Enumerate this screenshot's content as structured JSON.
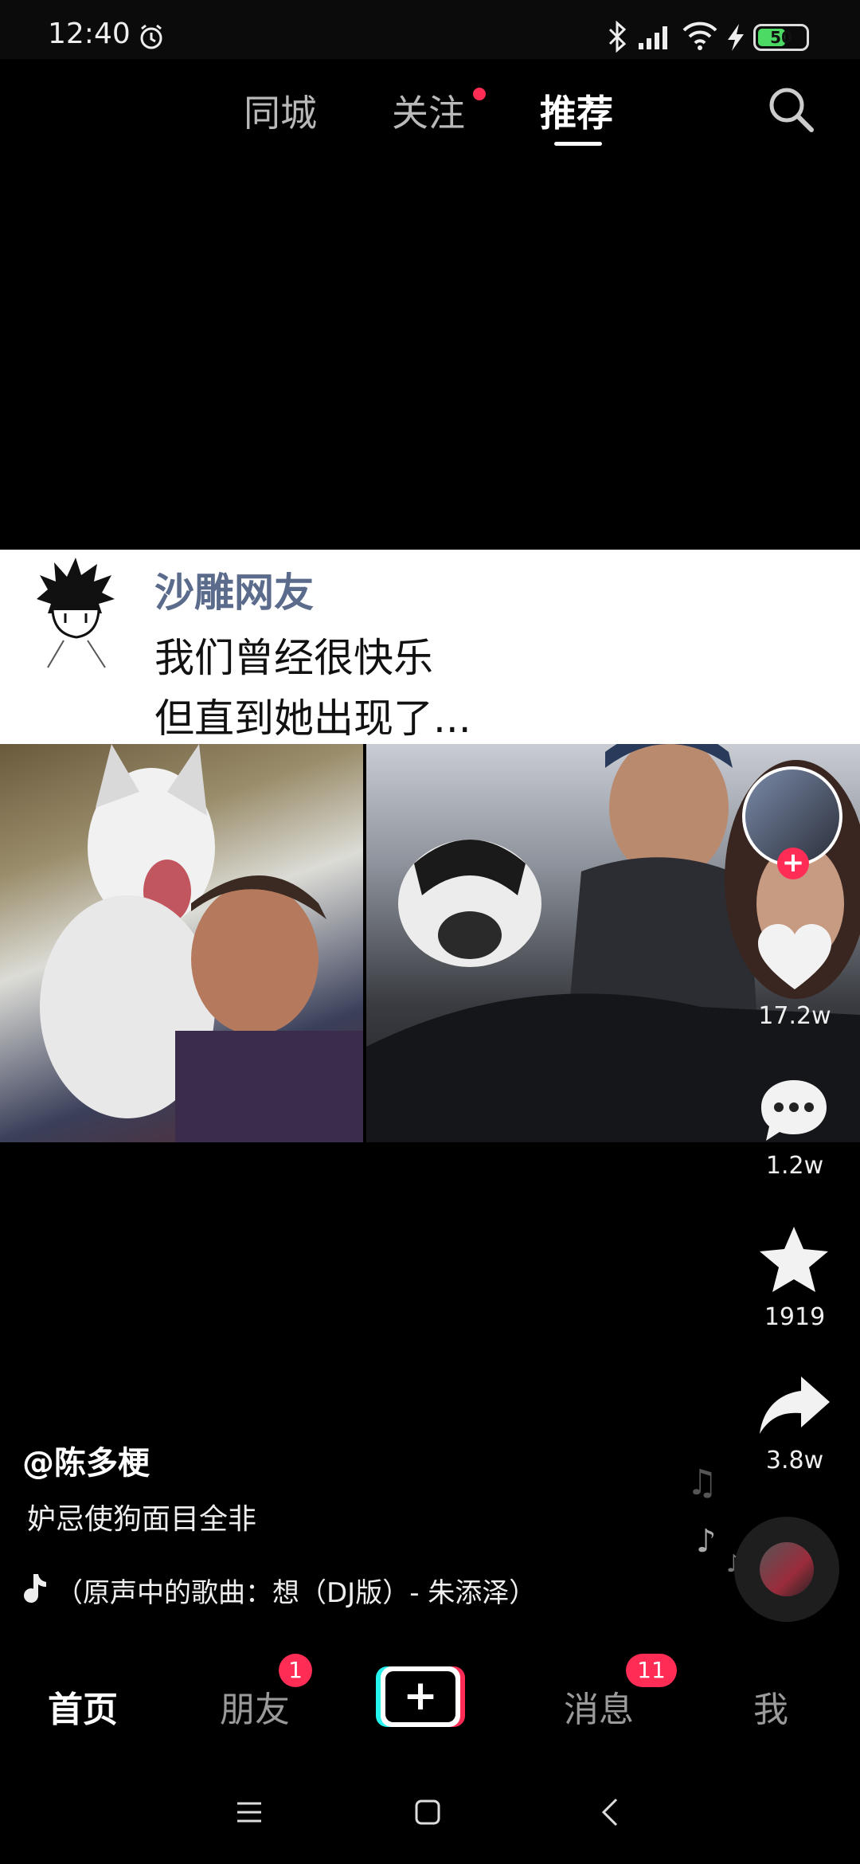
{
  "status_bar": {
    "time": "12:40",
    "battery": "50"
  },
  "top_tabs": {
    "nearby": "同城",
    "following": "关注",
    "recommend": "推荐"
  },
  "caption_card": {
    "name": "沙雕网友",
    "line1": "我们曾经很快乐",
    "line2": "但直到她出现了..."
  },
  "actions": {
    "likes": "17.2w",
    "comments": "1.2w",
    "favorites": "1919",
    "shares": "3.8w",
    "follow_symbol": "+"
  },
  "video": {
    "author": "@陈多梗",
    "description": "妒忌使狗面目全非",
    "music": "（原声中的歌曲：想（DJ版）- 朱添泽）"
  },
  "bottom_nav": {
    "home": "首页",
    "friends": "朋友",
    "friends_badge": "1",
    "create_symbol": "+",
    "messages": "消息",
    "messages_badge": "11",
    "me": "我"
  },
  "colors": {
    "accent": "#ff2d55",
    "cyan": "#25f4ee",
    "caption_name": "#5b6b8c"
  },
  "icons": [
    "alarm-icon",
    "bluetooth-icon",
    "signal-icon",
    "wifi-icon",
    "charging-icon",
    "search-icon",
    "heart-icon",
    "comment-icon",
    "star-icon",
    "share-icon",
    "music-note-icon",
    "menu-icon",
    "home-icon",
    "back-icon"
  ]
}
